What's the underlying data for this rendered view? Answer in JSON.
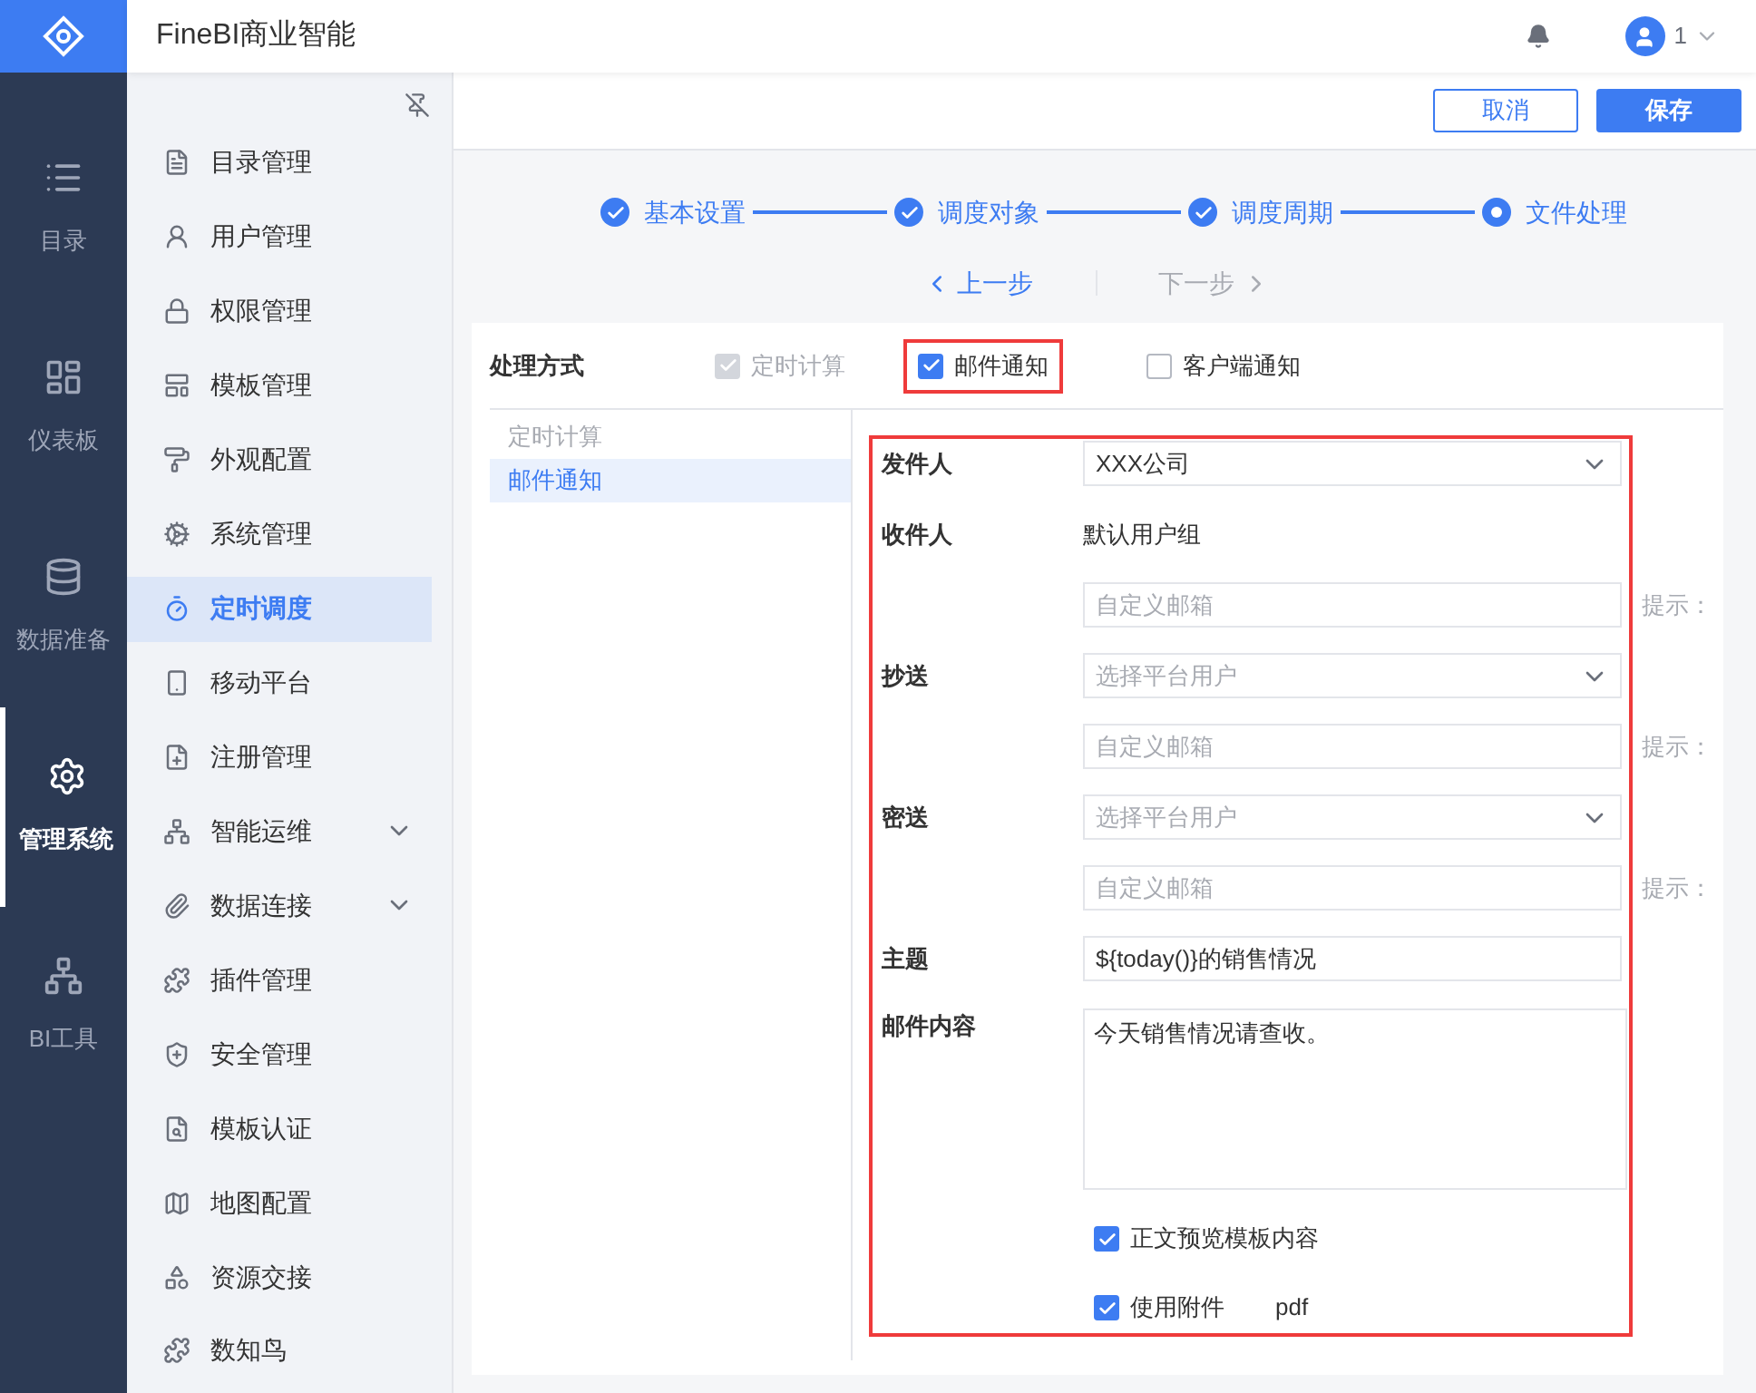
{
  "app": {
    "title": "FineBI商业智能",
    "user": "1"
  },
  "nav": [
    {
      "label": "目录",
      "selected": false
    },
    {
      "label": "仪表板",
      "selected": false
    },
    {
      "label": "数据准备",
      "selected": false
    },
    {
      "label": "管理系统",
      "selected": true
    },
    {
      "label": "BI工具",
      "selected": false
    }
  ],
  "sidebar": {
    "items": [
      {
        "label": "目录管理",
        "selected": false,
        "expandable": false
      },
      {
        "label": "用户管理",
        "selected": false,
        "expandable": false
      },
      {
        "label": "权限管理",
        "selected": false,
        "expandable": false
      },
      {
        "label": "模板管理",
        "selected": false,
        "expandable": false
      },
      {
        "label": "外观配置",
        "selected": false,
        "expandable": false
      },
      {
        "label": "系统管理",
        "selected": false,
        "expandable": false
      },
      {
        "label": "定时调度",
        "selected": true,
        "expandable": false
      },
      {
        "label": "移动平台",
        "selected": false,
        "expandable": false
      },
      {
        "label": "注册管理",
        "selected": false,
        "expandable": false
      },
      {
        "label": "智能运维",
        "selected": false,
        "expandable": true
      },
      {
        "label": "数据连接",
        "selected": false,
        "expandable": true
      },
      {
        "label": "插件管理",
        "selected": false,
        "expandable": false
      },
      {
        "label": "安全管理",
        "selected": false,
        "expandable": false
      },
      {
        "label": "模板认证",
        "selected": false,
        "expandable": false
      },
      {
        "label": "地图配置",
        "selected": false,
        "expandable": false
      },
      {
        "label": "资源交接",
        "selected": false,
        "expandable": false
      },
      {
        "label": "数知鸟",
        "selected": false,
        "expandable": false
      }
    ]
  },
  "actions": [
    "取消",
    "保存"
  ],
  "steps": [
    {
      "label": "基本设置",
      "done": true
    },
    {
      "label": "调度对象",
      "done": true
    },
    {
      "label": "调度周期",
      "done": true
    },
    {
      "label": "文件处理",
      "done": false
    }
  ],
  "pager": {
    "prev": "上一步",
    "next": "下一步",
    "next_disabled": true
  },
  "methods": {
    "label": "处理方式",
    "options": [
      {
        "label": "定时计算",
        "checked": true,
        "disabled": true,
        "highlighted": false
      },
      {
        "label": "邮件通知",
        "checked": true,
        "disabled": false,
        "highlighted": true
      },
      {
        "label": "客户端通知",
        "checked": false,
        "disabled": false,
        "highlighted": false
      }
    ]
  },
  "method_list": [
    {
      "label": "定时计算",
      "selected": false
    },
    {
      "label": "邮件通知",
      "selected": true
    }
  ],
  "mail_form": [
    {
      "kind": "select",
      "label": "发件人",
      "value": "XXX公司"
    },
    {
      "kind": "text",
      "label": "收件人",
      "value": "默认用户组"
    },
    {
      "kind": "input",
      "placeholder": "自定义邮箱",
      "hint": "提示："
    },
    {
      "kind": "select",
      "label": "抄送",
      "placeholder": "选择平台用户"
    },
    {
      "kind": "input",
      "placeholder": "自定义邮箱",
      "hint": "提示："
    },
    {
      "kind": "select",
      "label": "密送",
      "placeholder": "选择平台用户"
    },
    {
      "kind": "input",
      "placeholder": "自定义邮箱",
      "hint": "提示："
    },
    {
      "kind": "input",
      "label": "主题",
      "value": "${today()}的销售情况"
    },
    {
      "kind": "textarea",
      "label": "邮件内容",
      "value": "今天销售情况请查收。"
    },
    {
      "kind": "checkbox",
      "text": "正文预览模板内容",
      "checked": true
    },
    {
      "kind": "checkbox",
      "text": "使用附件",
      "checked": true,
      "extra": "pdf"
    }
  ]
}
